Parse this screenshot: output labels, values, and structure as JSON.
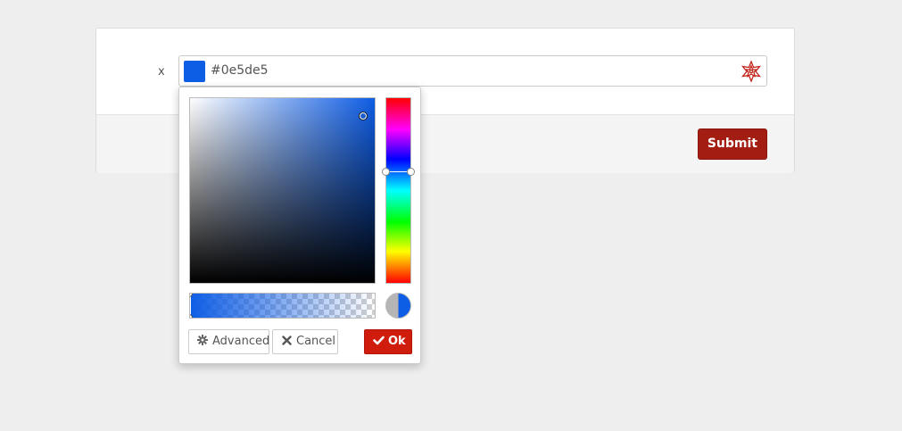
{
  "form": {
    "field_label": "x",
    "color_value": "#0e5de5",
    "submit_label": "Submit"
  },
  "picker": {
    "advanced_label": "Advanced",
    "cancel_label": "Cancel",
    "ok_label": "Ok",
    "icons": {
      "advanced": "gear-icon",
      "cancel": "close-icon",
      "ok": "check-icon",
      "field": "color-picker-icon"
    }
  },
  "colors": {
    "selected": "#0e5de5",
    "submit_bg": "#a41d12",
    "ok_bg": "#d01c0c"
  }
}
